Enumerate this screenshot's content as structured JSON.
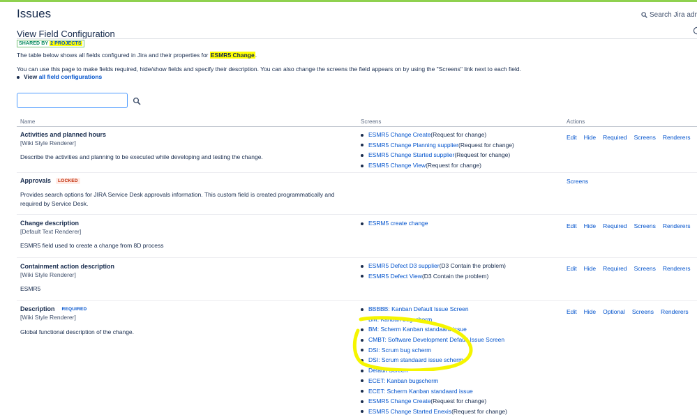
{
  "header": {
    "title": "Issues",
    "search_placeholder": "Search Jira admin"
  },
  "page": {
    "section_title": "View Field Configuration",
    "shared_by_prefix": "SHARED BY",
    "shared_by_projects": "2 PROJECTS",
    "intro_prefix": "The table below shows all fields configured in Jira and their properties for",
    "config_name": "ESMR5 Change",
    "intro_suffix": ".",
    "intro_line2": "You can use this page to make fields required, hide/show fields and specify their description. You can also change the screens the field appears on by using the \"Screens\" link next to each field.",
    "view_all_prefix": "View",
    "view_all_link": "all field configurations"
  },
  "filter": {
    "value": "",
    "placeholder": ""
  },
  "table": {
    "headers": {
      "name": "Name",
      "screens": "Screens",
      "actions": "Actions"
    },
    "rows": [
      {
        "name": "Activities and planned hours",
        "badge": "",
        "renderer": "[Wiki Style Renderer]",
        "description": "Describe the activities and planning to be executed while developing and testing the change.",
        "screens": [
          {
            "link": "ESMR5 Change Create",
            "suffix": "(Request for change)"
          },
          {
            "link": "ESMR5 Change Planning supplier",
            "suffix": "(Request for change)"
          },
          {
            "link": "ESMR5 Change Started supplier",
            "suffix": "(Request for change)"
          },
          {
            "link": "ESMR5 Change View",
            "suffix": "(Request for change)"
          }
        ],
        "actions": [
          "Edit",
          "Hide",
          "Required",
          "Screens",
          "Renderers"
        ]
      },
      {
        "name": "Approvals",
        "badge": "LOCKED",
        "renderer": "",
        "description": "Provides search options for JIRA Service Desk approvals information. This custom field is created programmatically and required by Service Desk.",
        "screens": [],
        "actions": [
          "Screens"
        ]
      },
      {
        "name": "Change description",
        "badge": "",
        "renderer": "[Default Text Renderer]",
        "description": "ESMR5 field used to create a change from 8D process",
        "screens": [
          {
            "link": "ESRM5 create change",
            "suffix": ""
          }
        ],
        "actions": [
          "Edit",
          "Hide",
          "Required",
          "Screens",
          "Renderers"
        ]
      },
      {
        "name": "Containment action description",
        "badge": "",
        "renderer": "[Wiki Style Renderer]",
        "description": "ESMR5",
        "screens": [
          {
            "link": "ESMR5 Defect D3 supplier",
            "suffix": "(D3 Contain the problem)"
          },
          {
            "link": "ESMR5 Defect View",
            "suffix": "(D3 Contain the problem)"
          }
        ],
        "actions": [
          "Edit",
          "Hide",
          "Required",
          "Screens",
          "Renderers"
        ]
      },
      {
        "name": "Description",
        "badge": "REQUIRED",
        "renderer": "[Wiki Style Renderer]",
        "description": "Global functional description of the change.",
        "screens": [
          {
            "link": "BBBBB: Kanban Default Issue Screen",
            "suffix": ""
          },
          {
            "link": "BM: Kanban bugscherm",
            "suffix": ""
          },
          {
            "link": "BM: Scherm Kanban standaard issue",
            "suffix": ""
          },
          {
            "link": "CMBT: Software Development Default Issue Screen",
            "suffix": ""
          },
          {
            "link": "DSI: Scrum bug scherm",
            "suffix": ""
          },
          {
            "link": "DSI: Scrum standaard issue scherm",
            "suffix": ""
          },
          {
            "link": "Default Screen",
            "suffix": ""
          },
          {
            "link": "ECET: Kanban bugscherm",
            "suffix": ""
          },
          {
            "link": "ECET: Scherm Kanban standaard issue",
            "suffix": ""
          },
          {
            "link": "ESMR5 Change Create",
            "suffix": "(Request for change)"
          },
          {
            "link": "ESMR5 Change Started Enexis",
            "suffix": "(Request for change)"
          }
        ],
        "actions": [
          "Edit",
          "Hide",
          "Optional",
          "Screens",
          "Renderers"
        ]
      }
    ]
  },
  "colors": {
    "link": "#0052cc",
    "highlight": "#ffff00",
    "annotation": "#f5f500",
    "top_bar": "#8fd14f"
  }
}
